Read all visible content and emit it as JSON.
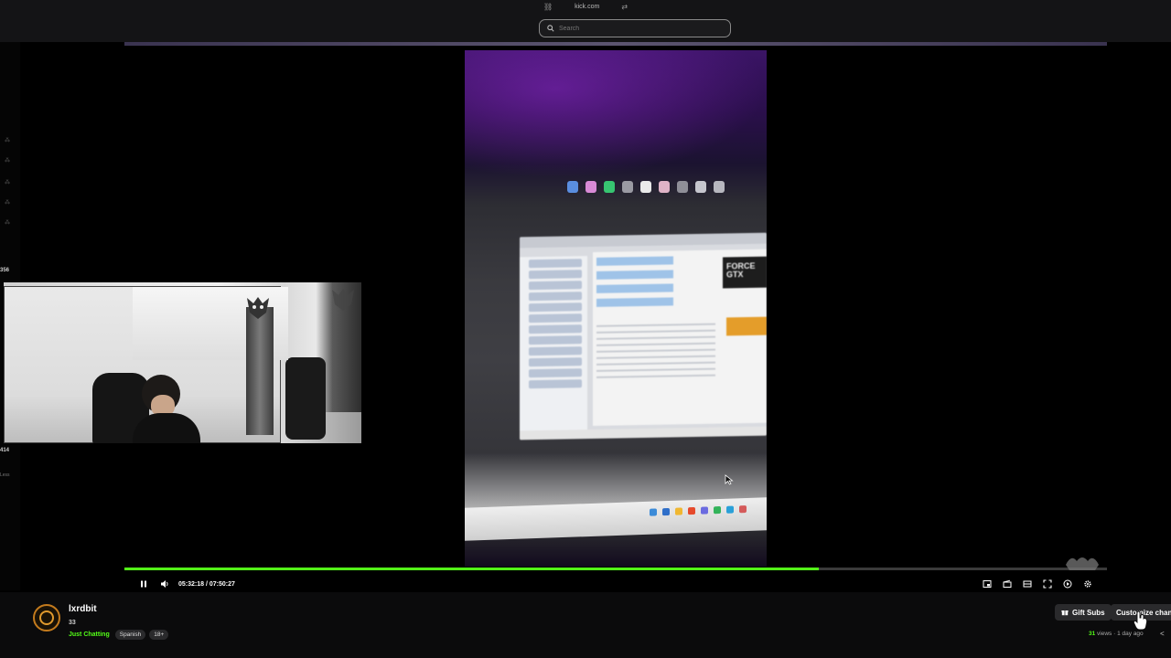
{
  "browser": {
    "url": "kick.com",
    "search_placeholder": "Search"
  },
  "left_rail": {
    "viewer_count_a": "356",
    "viewer_count_b": "414",
    "less_label": "Less"
  },
  "video": {
    "gpu_badge": "FORCE\nGTX"
  },
  "player": {
    "current_time": "05:32:18",
    "separator": "/",
    "total_time": "07:50:27",
    "progress_fraction": 0.707,
    "accent_color": "#53fc18"
  },
  "channel": {
    "name": "lxrdbit",
    "followers": "33",
    "category": "Just Chatting",
    "tags": [
      "Spanish",
      "18+"
    ],
    "views_count": "31",
    "views_label": "views",
    "time_ago": "1 day ago"
  },
  "actions": {
    "gift_subs_label": "Gift Subs",
    "customize_label": "Customize channel"
  },
  "icons": {
    "search": "search-icon",
    "link": "link-icon",
    "settings_sliders": "sliders-icon",
    "pause": "pause-icon",
    "volume": "volume-icon",
    "pip": "picture-in-picture-icon",
    "clip": "clip-icon",
    "theater": "theater-mode-icon",
    "fullscreen": "fullscreen-icon",
    "settings": "gear-icon",
    "gift": "gift-icon"
  }
}
